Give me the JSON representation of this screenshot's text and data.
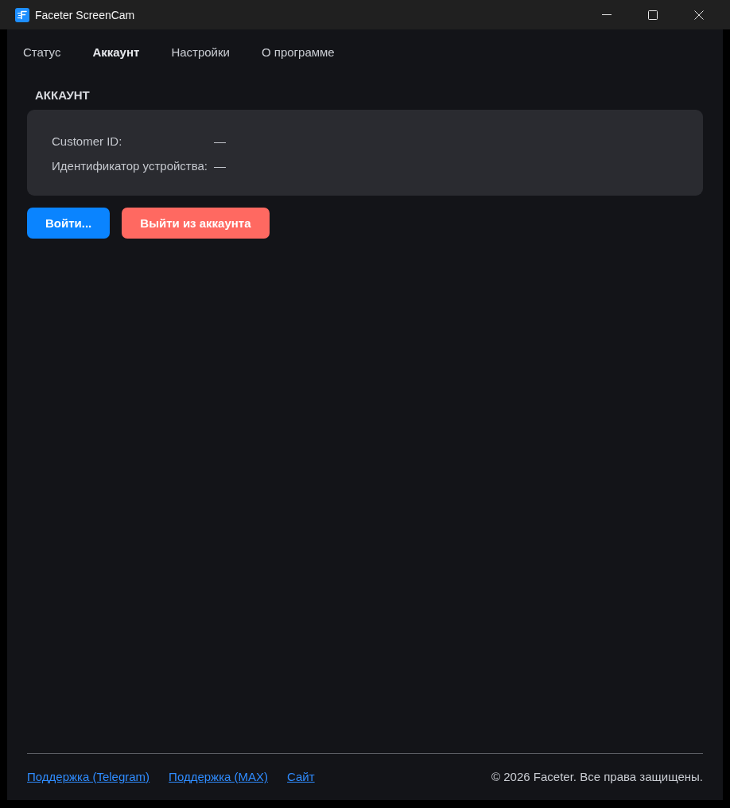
{
  "window": {
    "title": "Faceter ScreenCam"
  },
  "tabs": [
    {
      "label": "Статус",
      "selected": false
    },
    {
      "label": "Аккаунт",
      "selected": true
    },
    {
      "label": "Настройки",
      "selected": false
    },
    {
      "label": "О программе",
      "selected": false
    }
  ],
  "account": {
    "heading": "АККАУНТ",
    "rows": [
      {
        "cells": [
          "Customer ID:",
          "—"
        ]
      },
      {
        "cells": [
          "Идентификатор устройства:",
          "—"
        ]
      }
    ]
  },
  "buttons": [
    {
      "label": "Войти...",
      "kind": "primary"
    },
    {
      "label": "Выйти из аккаунта",
      "kind": "danger"
    }
  ],
  "footer": {
    "links": [
      "Поддержка (Telegram)",
      "Поддержка (MAX)",
      "Сайт"
    ],
    "copyright": "© 2026 Faceter. Все права защищены."
  }
}
